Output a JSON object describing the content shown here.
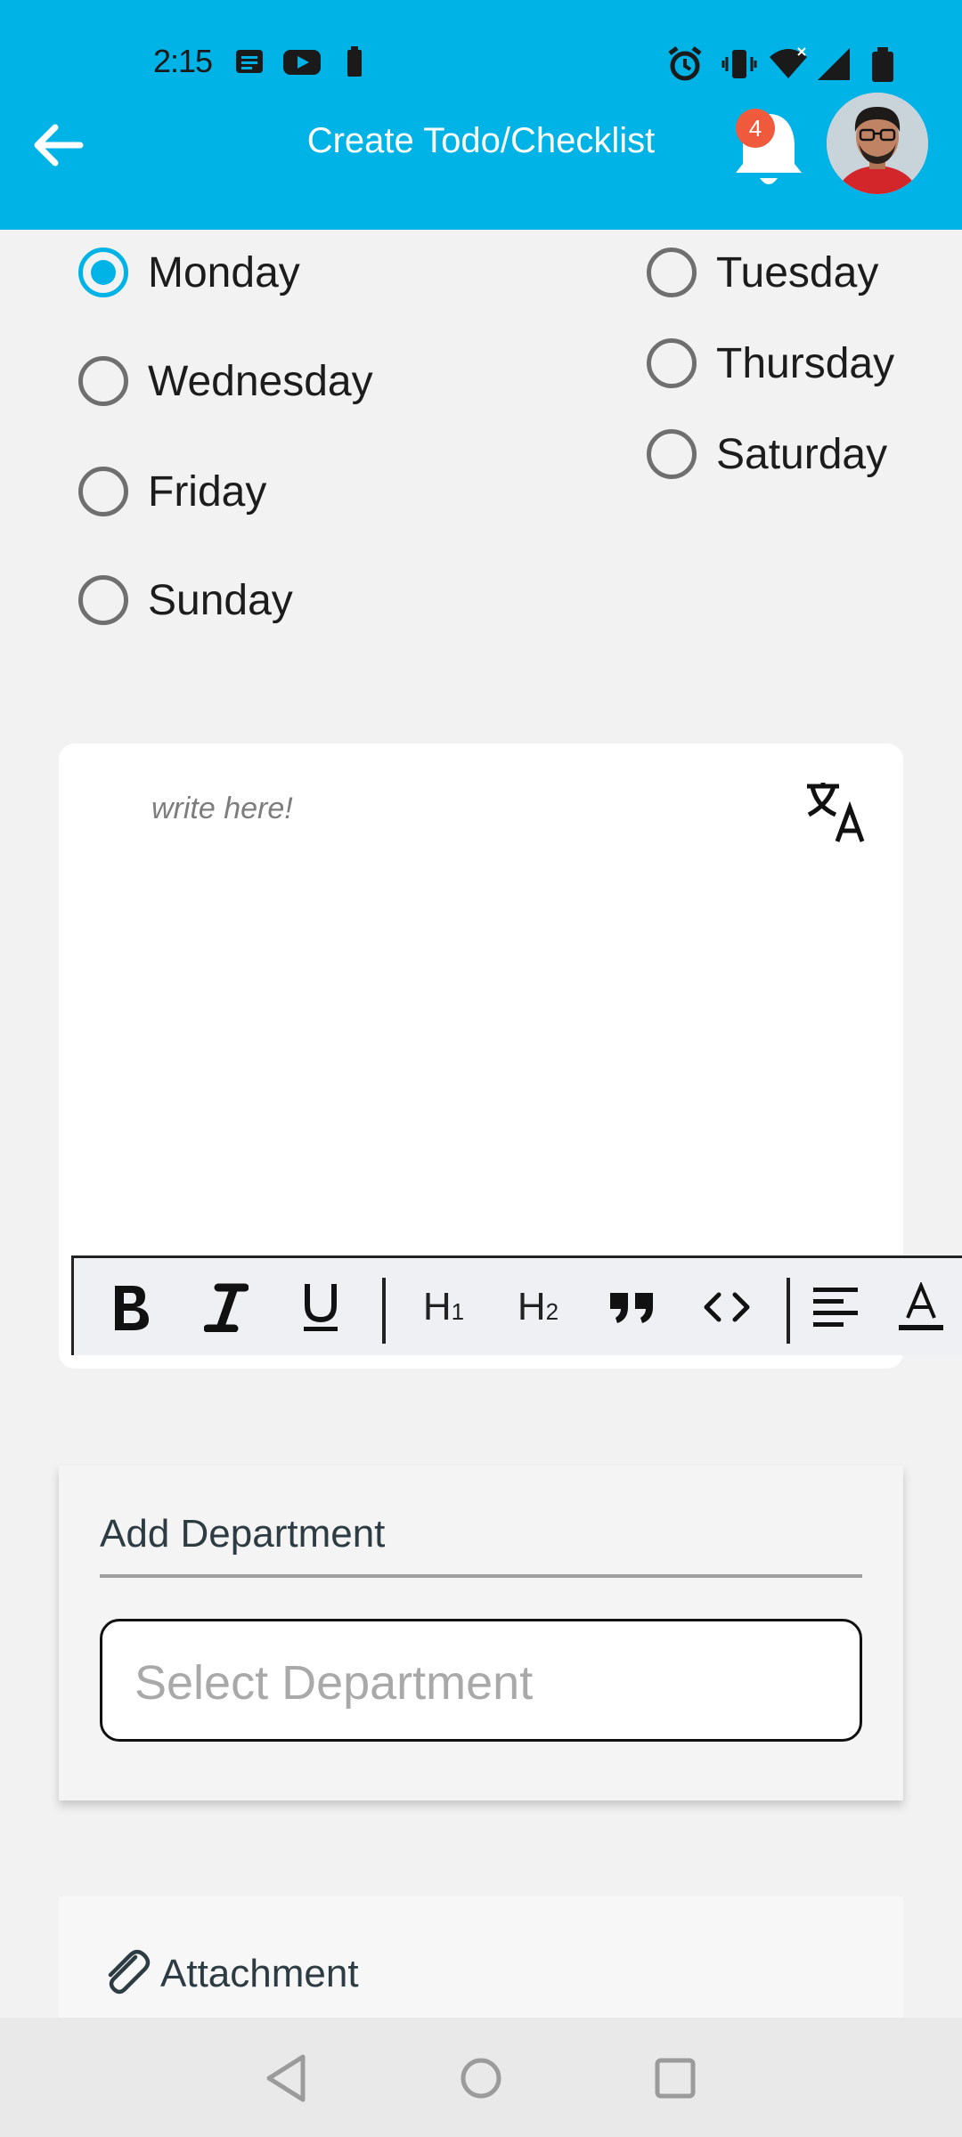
{
  "status_bar": {
    "time": "2:15"
  },
  "header": {
    "title": "Create Todo/Checklist",
    "notification_count": "4"
  },
  "days": [
    {
      "label": "Monday",
      "selected": true
    },
    {
      "label": "Tuesday",
      "selected": false
    },
    {
      "label": "Wednesday",
      "selected": false
    },
    {
      "label": "Thursday",
      "selected": false
    },
    {
      "label": "Friday",
      "selected": false
    },
    {
      "label": "Saturday",
      "selected": false
    },
    {
      "label": "Sunday",
      "selected": false
    }
  ],
  "editor": {
    "placeholder": "write here!",
    "toolbar_h1": "H",
    "toolbar_h1_sub": "1",
    "toolbar_h2": "H",
    "toolbar_h2_sub": "2"
  },
  "department": {
    "label": "Add Department",
    "select_placeholder": "Select Department"
  },
  "attachment": {
    "label": "Attachment"
  },
  "colors": {
    "accent": "#00b3e6",
    "badge": "#ef5a3c"
  },
  "icons": [
    "back-arrow-icon",
    "bell-icon",
    "translate-icon",
    "bold-icon",
    "italic-icon",
    "underline-icon",
    "quote-icon",
    "code-icon",
    "align-left-icon",
    "text-color-icon",
    "paperclip-icon"
  ]
}
